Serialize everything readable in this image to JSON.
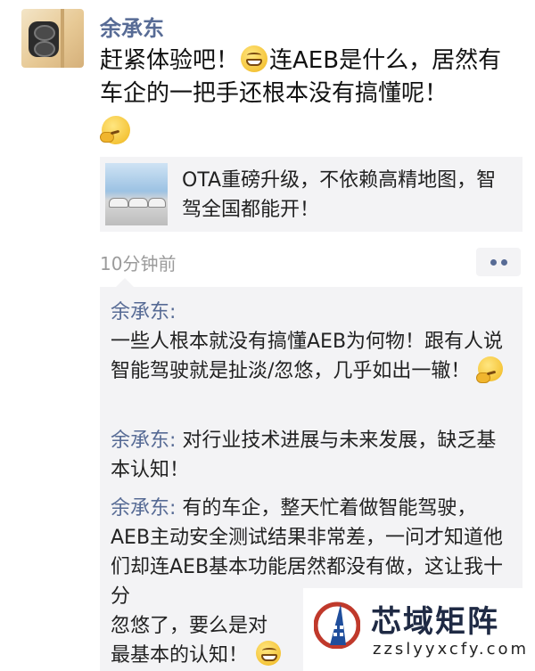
{
  "post": {
    "author": "余承东",
    "text_before_emoji": "赶紧体验吧！",
    "text_after_emoji": "连AEB是什么，居然有车企的一把手还根本没有搞懂呢！",
    "emoji_inline": "grinning-face-icon",
    "emoji_trailing": "thinking-face-icon"
  },
  "link_card": {
    "text": "OTA重磅升级，不依赖高精地图，智驾全国都能开！",
    "thumbnail": "cars-photo"
  },
  "meta": {
    "time": "10分钟前",
    "more_icon": "two-dots-icon"
  },
  "comments": [
    {
      "name": "余承东:",
      "text": "一些人根本就没有搞懂AEB为何物！跟有人说智能驾驶就是扯淡/忽悠，几乎如出一辙！",
      "emoji": "thinking-face-icon"
    },
    {
      "name": "余承东:",
      "text": "对行业技术进展与未来发展，缺乏基本认知！"
    },
    {
      "name": "余承东:",
      "text": "有的车企，整天忙着做智能驾驶，AEB主动安全测试结果非常差，一问才知道他们却连AEB基本功能居然都没有做，这让我十分",
      "text_line5": "忽悠了，要么是对",
      "text_line6": "最基本的认知！",
      "emoji": "grinning-face-icon"
    }
  ],
  "watermark": {
    "title": "芯域矩阵",
    "subtitle": "zzslyyxcfy.com"
  },
  "colors": {
    "link_blue": "#576b95",
    "comment_bg": "#f3f3f5",
    "time_gray": "#9b9b9b"
  }
}
